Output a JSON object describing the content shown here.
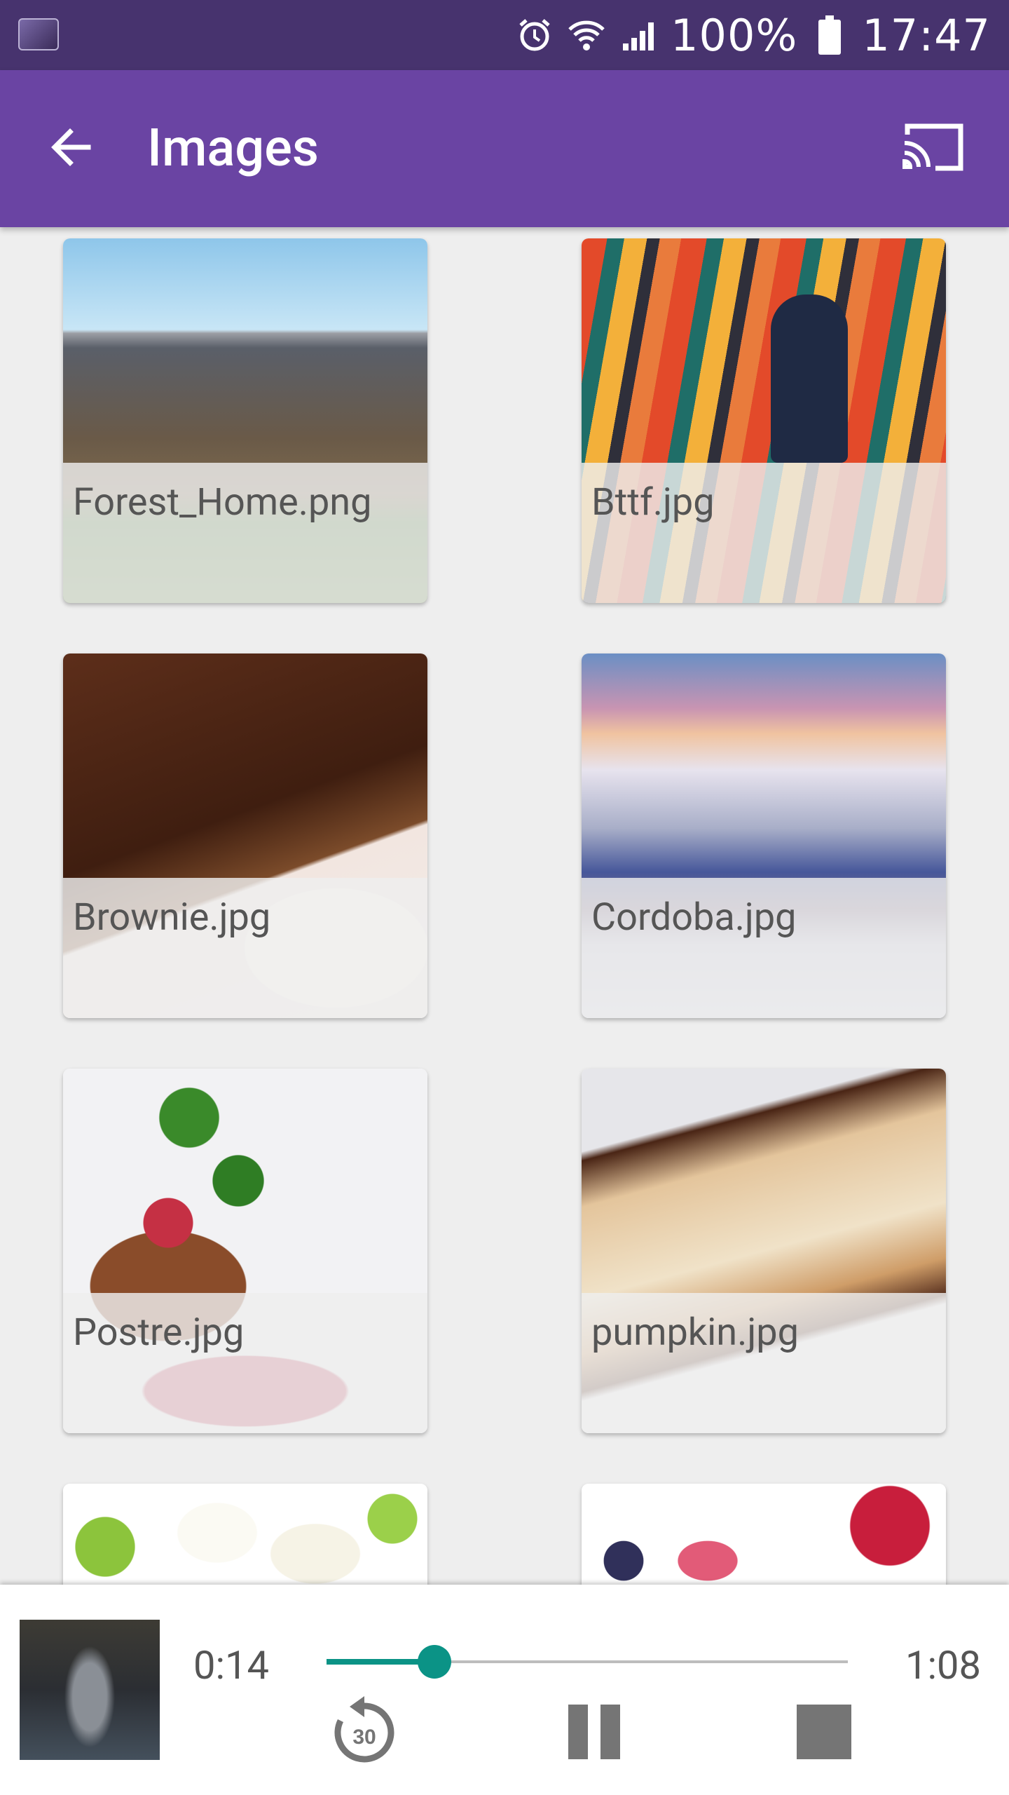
{
  "status_bar": {
    "battery": "100%",
    "time": "17:47",
    "icons": [
      "alarm-icon",
      "wifi-icon",
      "signal-icon",
      "battery-icon"
    ]
  },
  "app_bar": {
    "title": "Images",
    "back_icon": "arrow-back-icon",
    "cast_icon": "cast-icon",
    "background": "#6a44a3"
  },
  "grid": {
    "items": [
      {
        "label": "Forest_Home.png"
      },
      {
        "label": "Bttf.jpg"
      },
      {
        "label": "Brownie.jpg"
      },
      {
        "label": "Cordoba.jpg"
      },
      {
        "label": "Postre.jpg"
      },
      {
        "label": "pumpkin.jpg"
      },
      {
        "label": ""
      },
      {
        "label": ""
      }
    ]
  },
  "player": {
    "current_time": "0:14",
    "total_time": "1:08",
    "progress": 0.207,
    "accent": "#0b9386",
    "replay_label": "30",
    "controls": [
      "replay-30-icon",
      "pause-icon",
      "stop-icon"
    ]
  }
}
